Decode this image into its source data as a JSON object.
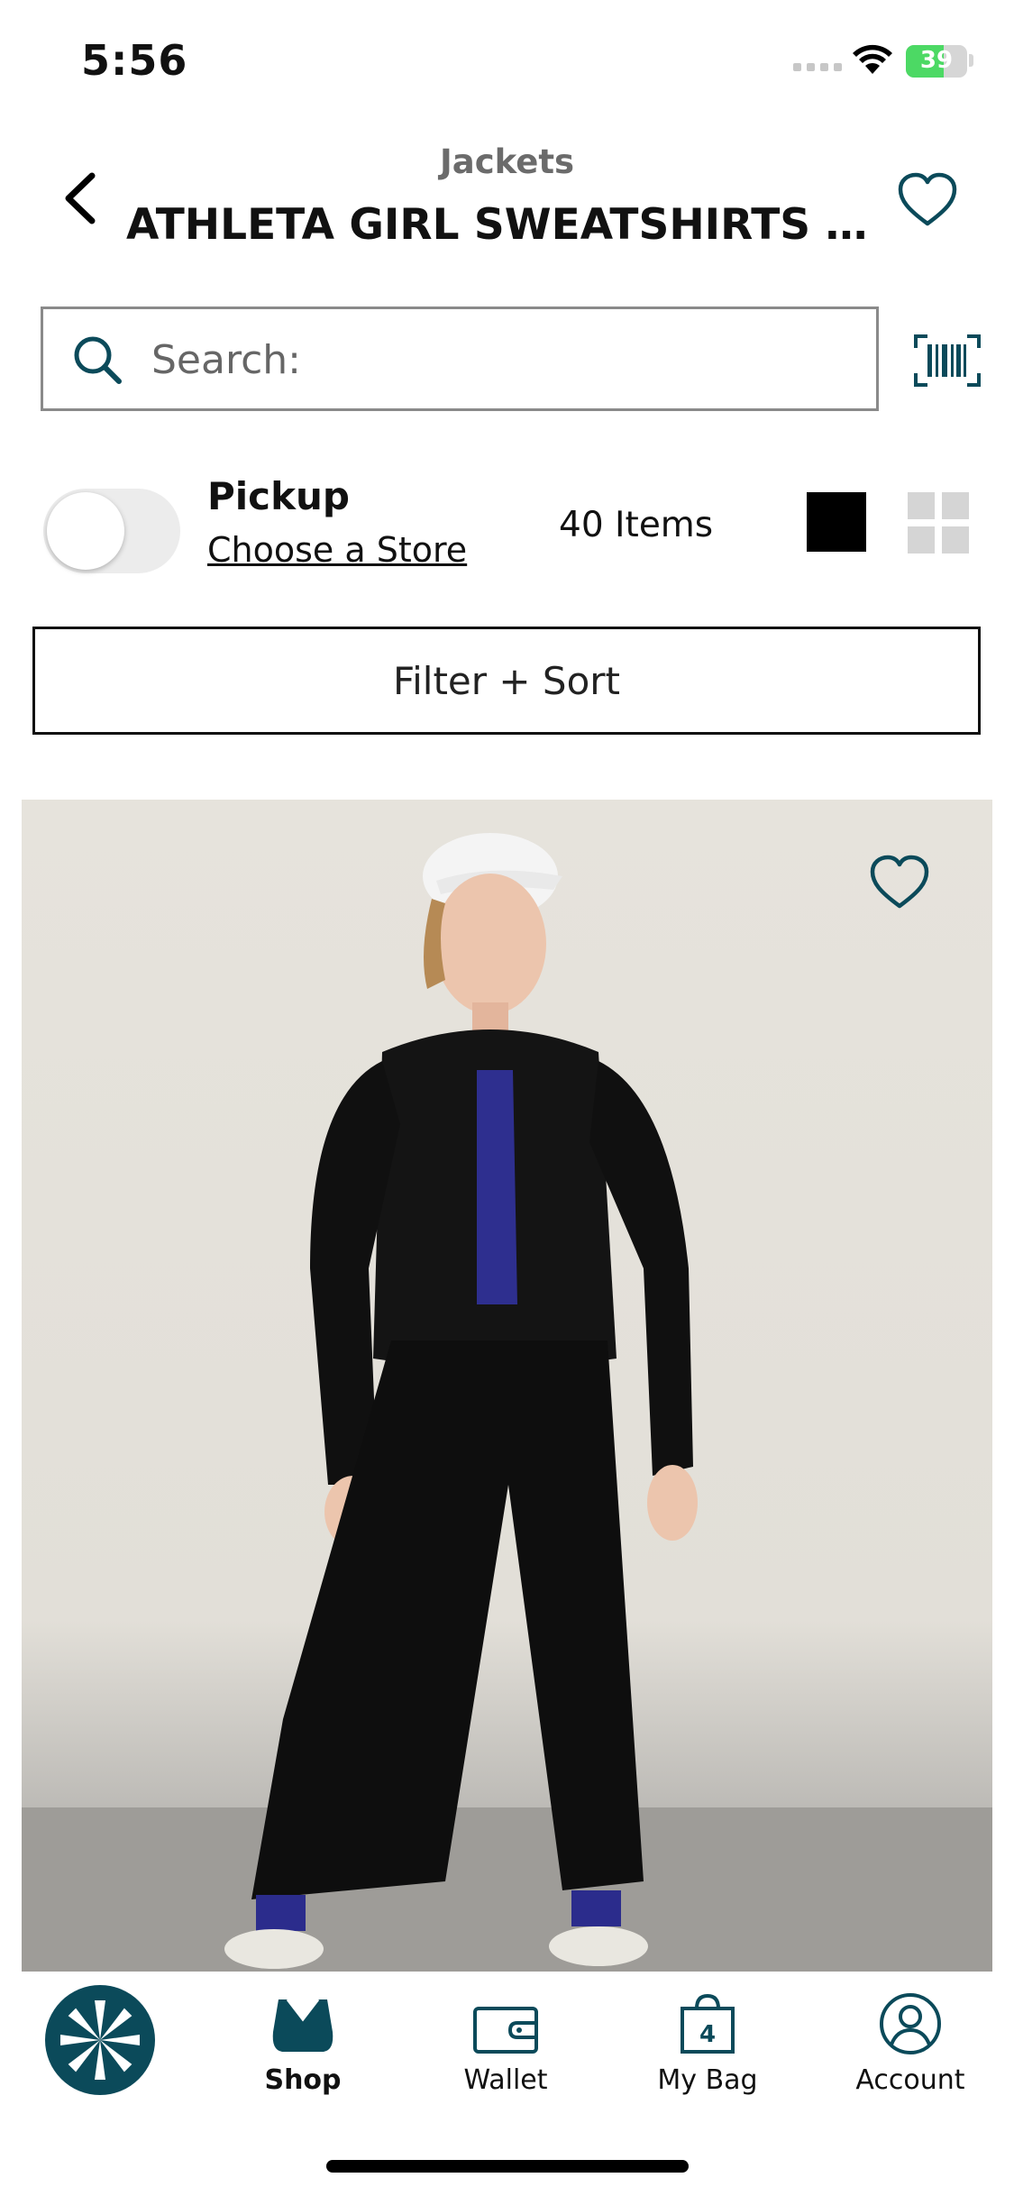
{
  "status_bar": {
    "time": "5:56",
    "battery": "39"
  },
  "header": {
    "category": "Jackets",
    "title": "ATHLETA GIRL SWEATSHIRTS & JACKETS"
  },
  "search": {
    "placeholder": "Search:"
  },
  "pickup": {
    "label": "Pickup",
    "store_link": "Choose a Store",
    "enabled": false
  },
  "items_count": "40 Items",
  "filter_sort_label": "Filter + Sort",
  "tabbar": {
    "shop": "Shop",
    "wallet": "Wallet",
    "bag": "My Bag",
    "bag_count": "4",
    "account": "Account"
  },
  "colors": {
    "brand_teal": "#0b4a5a",
    "battery_green": "#4cd964"
  }
}
